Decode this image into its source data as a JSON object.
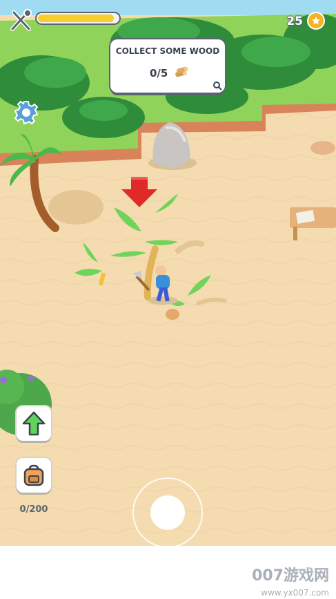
{
  "hud": {
    "coins": "25",
    "progress_fraction": 0.95
  },
  "quest": {
    "title": "COLLECT SOME WOOD",
    "progress": "0/5"
  },
  "inventory": {
    "capacity": "0/200"
  },
  "watermark": {
    "brand": "007游戏网",
    "url": "www.yx007.com"
  },
  "colors": {
    "sand": "#f4dcb0",
    "grass": "#8fd35a",
    "progress_fill": "#f6cf2a",
    "coin": "#f5b41f",
    "arrow_red": "#e02a2a",
    "upgrade_green": "#5fd35a"
  }
}
